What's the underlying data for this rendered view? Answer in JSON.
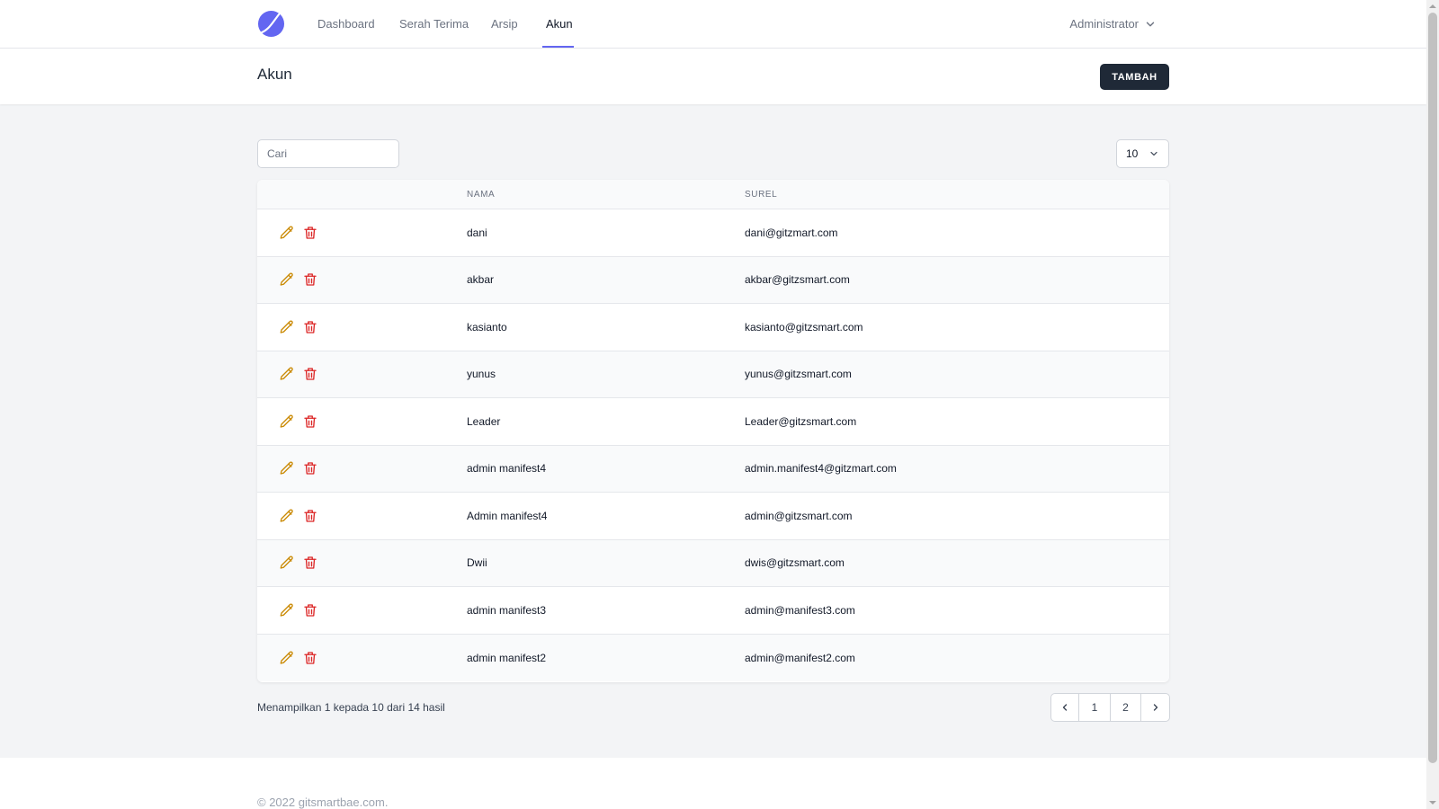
{
  "nav": {
    "items": [
      {
        "label": "Dashboard",
        "active": false
      },
      {
        "label": "Serah Terima",
        "active": false
      },
      {
        "label": "Arsip",
        "active": false
      },
      {
        "label": "Akun",
        "active": true
      }
    ],
    "user": "Administrator",
    "logo_icon": "crescent-logo-icon"
  },
  "header": {
    "title": "Akun",
    "add_label": "TAMBAH"
  },
  "search": {
    "placeholder": "Cari",
    "value": ""
  },
  "per_page": {
    "selected": "10"
  },
  "table": {
    "columns": [
      "NAMA",
      "SUREL"
    ],
    "rows": [
      {
        "nama": "dani",
        "surel": "dani@gitzmart.com"
      },
      {
        "nama": "akbar",
        "surel": "akbar@gitzsmart.com"
      },
      {
        "nama": "kasianto",
        "surel": "kasianto@gitzsmart.com"
      },
      {
        "nama": "yunus",
        "surel": "yunus@gitzsmart.com"
      },
      {
        "nama": "Leader",
        "surel": "Leader@gitzsmart.com"
      },
      {
        "nama": "admin manifest4",
        "surel": "admin.manifest4@gitzmart.com"
      },
      {
        "nama": "Admin manifest4",
        "surel": "admin@gitzsmart.com"
      },
      {
        "nama": "Dwii",
        "surel": "dwis@gitzsmart.com"
      },
      {
        "nama": "admin manifest3",
        "surel": "admin@manifest3.com"
      },
      {
        "nama": "admin manifest2",
        "surel": "admin@manifest2.com"
      }
    ],
    "row_icons": {
      "edit": "pencil-icon",
      "delete": "trash-icon"
    }
  },
  "pagination": {
    "summary": "Menampilkan 1 kepada 10 dari 14 hasil",
    "pages": [
      "1",
      "2"
    ]
  },
  "footer": {
    "text": "© 2022 gitsmartbae.com."
  },
  "colors": {
    "accent": "#6366f1",
    "primary_button": "#1f2937",
    "edit_icon": "#ca8a04",
    "delete_icon": "#dc2626"
  }
}
